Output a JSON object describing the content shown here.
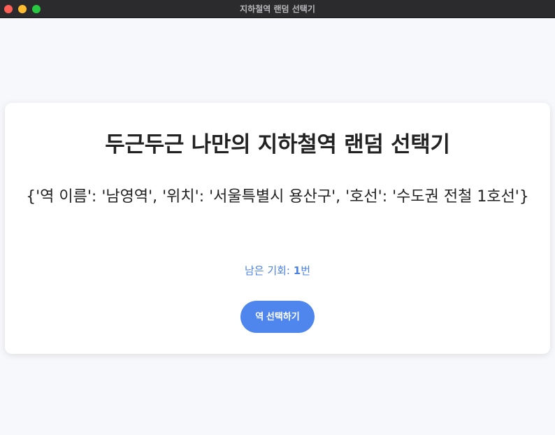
{
  "window": {
    "title": "지하철역 랜덤 선택기"
  },
  "card": {
    "heading": "두근두근 나만의 지하철역 랜덤 선택기",
    "result_text": "{'역 이름': '남영역', '위치': '서울특별시 용산구', '호선': '수도권 전철 1호선'}",
    "chances_label": "남은 기회: ",
    "chances_value": "1",
    "chances_unit": "번",
    "button_label": "역 선택하기"
  },
  "colors": {
    "accent": "#4f86ee",
    "chances_text": "#4a82e8",
    "background": "#f7f8fc",
    "card": "#ffffff",
    "titlebar": "#2b2b2d"
  }
}
